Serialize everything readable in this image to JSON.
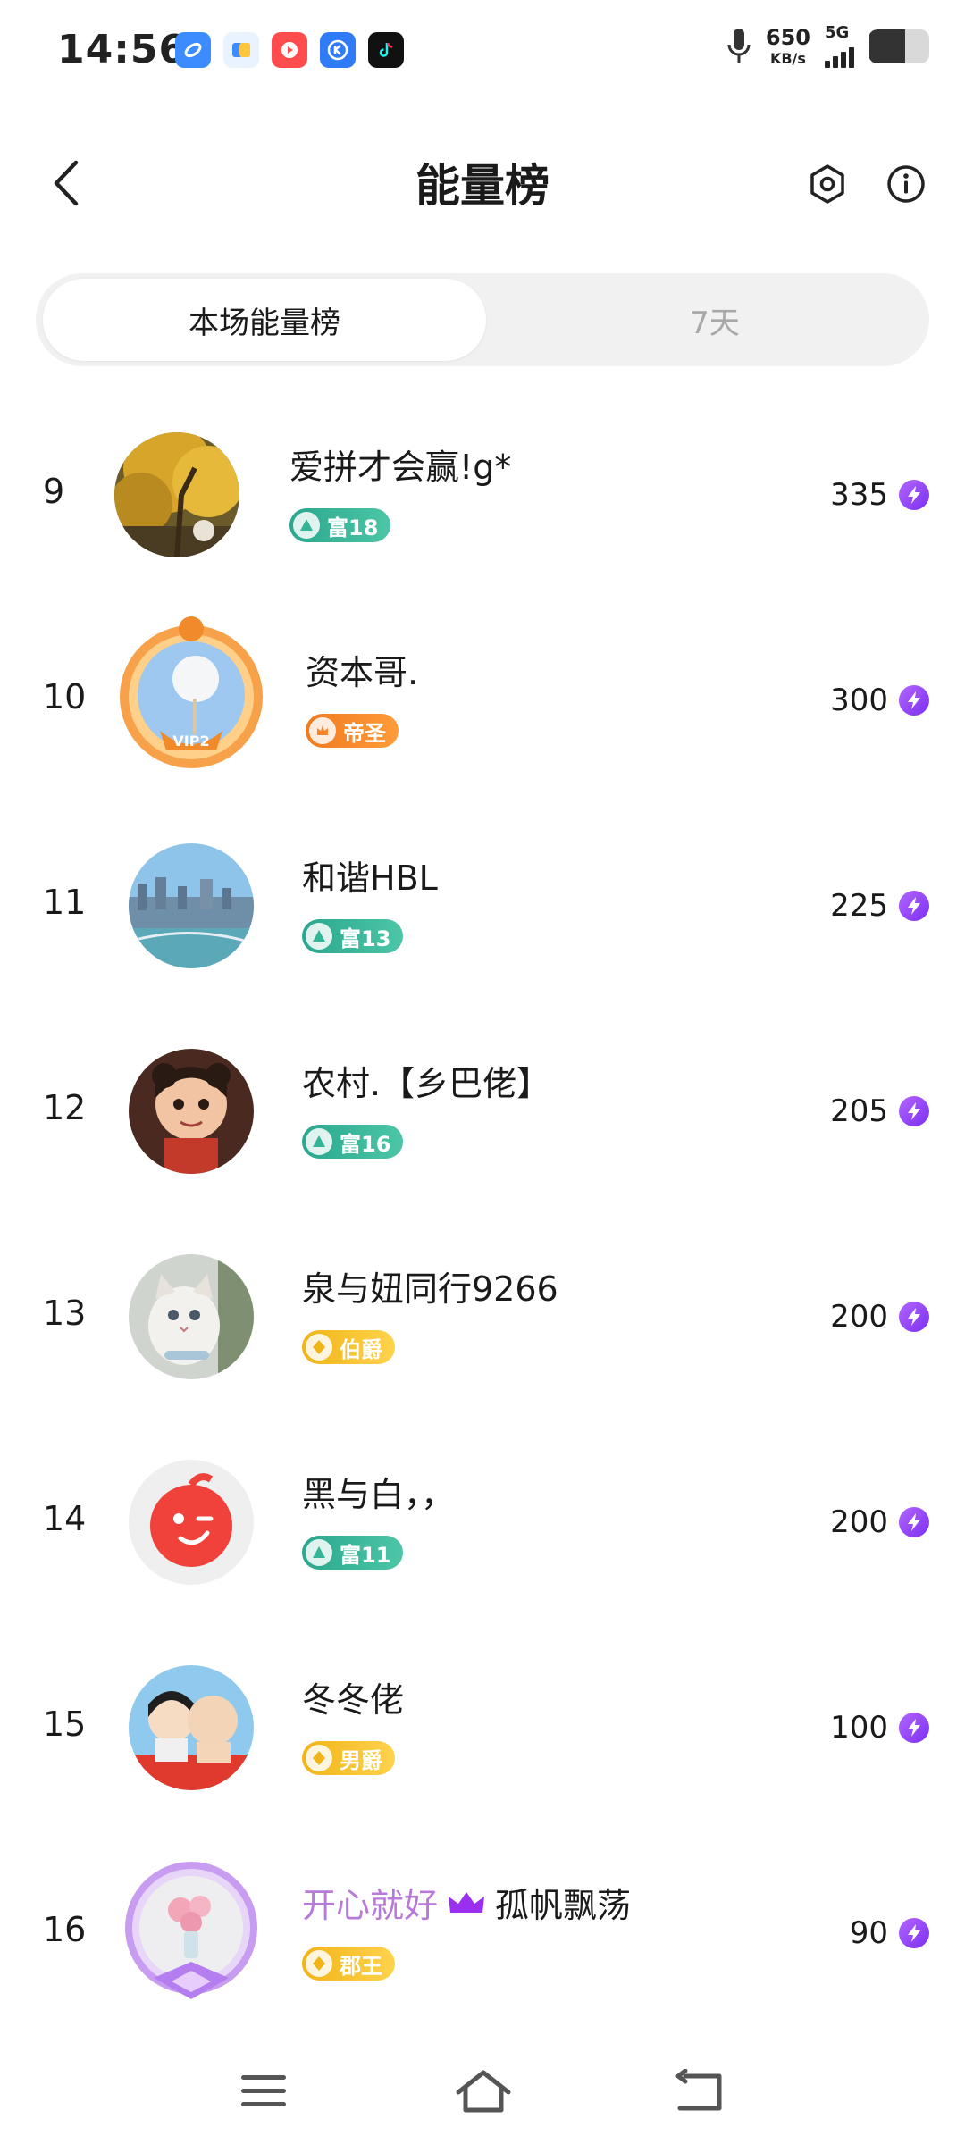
{
  "status_bar": {
    "time": "14:56",
    "net_speed_value": "650",
    "net_speed_unit": "KB/s",
    "network_type": "5G",
    "battery_level": 0.6,
    "apps": [
      {
        "icon": "blue-app-icon",
        "color": "#3d8cff"
      },
      {
        "icon": "files-app-icon",
        "color": "#6ab0ff"
      },
      {
        "icon": "video-app-icon",
        "color": "#ff4d4f"
      },
      {
        "icon": "k-app-icon",
        "color": "#2f7cf6"
      },
      {
        "icon": "tiktok-icon",
        "color": "#111111"
      }
    ]
  },
  "header": {
    "title": "能量榜"
  },
  "tabs": [
    {
      "label": "本场能量榜",
      "active": true
    },
    {
      "label": "7天",
      "active": false
    }
  ],
  "ranking": [
    {
      "rank": "9",
      "name": "爱拼才会赢!g*",
      "badge": "富18",
      "badge_style": "green",
      "score": "335"
    },
    {
      "rank": "10",
      "name": "资本哥.",
      "badge": "帝圣",
      "badge_style": "orange",
      "score": "300"
    },
    {
      "rank": "11",
      "name": "和谐HBL",
      "badge": "富13",
      "badge_style": "green",
      "score": "225"
    },
    {
      "rank": "12",
      "name": "农村.【乡巴佬】",
      "badge": "富16",
      "badge_style": "green",
      "score": "205"
    },
    {
      "rank": "13",
      "name": "泉与妞同行9266",
      "badge": "伯爵",
      "badge_style": "gold",
      "score": "200"
    },
    {
      "rank": "14",
      "name": "黑与白，，",
      "badge": "富11",
      "badge_style": "green",
      "score": "200"
    },
    {
      "rank": "15",
      "name": "冬冬佬",
      "badge": "男爵",
      "badge_style": "gold",
      "score": "100"
    },
    {
      "rank": "16",
      "name_tag": "开心就好",
      "name": "孤帆飘荡",
      "badge": "郡王",
      "badge_style": "gold",
      "score": "90"
    }
  ],
  "colors": {
    "energy": "#8a3cf5",
    "badge_green": "#34b496",
    "badge_orange": "#f7862a",
    "badge_gold": "#f5c030",
    "tag_purple": "#b77ad8"
  }
}
